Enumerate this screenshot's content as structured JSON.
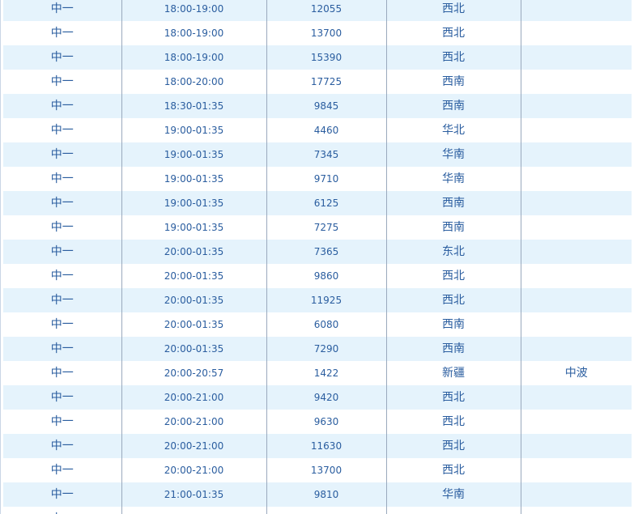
{
  "colors": {
    "stripe": "#e5f3fc",
    "text": "#2a5d9f",
    "divider": "#9aa9bd"
  },
  "rows": [
    {
      "channel": "中一",
      "time": "18:00-19:00",
      "freq": "12055",
      "region": "西北",
      "wave": ""
    },
    {
      "channel": "中一",
      "time": "18:00-19:00",
      "freq": "13700",
      "region": "西北",
      "wave": ""
    },
    {
      "channel": "中一",
      "time": "18:00-19:00",
      "freq": "15390",
      "region": "西北",
      "wave": ""
    },
    {
      "channel": "中一",
      "time": "18:00-20:00",
      "freq": "17725",
      "region": "西南",
      "wave": ""
    },
    {
      "channel": "中一",
      "time": "18:30-01:35",
      "freq": "9845",
      "region": "西南",
      "wave": ""
    },
    {
      "channel": "中一",
      "time": "19:00-01:35",
      "freq": "4460",
      "region": "华北",
      "wave": ""
    },
    {
      "channel": "中一",
      "time": "19:00-01:35",
      "freq": "7345",
      "region": "华南",
      "wave": ""
    },
    {
      "channel": "中一",
      "time": "19:00-01:35",
      "freq": "9710",
      "region": "华南",
      "wave": ""
    },
    {
      "channel": "中一",
      "time": "19:00-01:35",
      "freq": "6125",
      "region": "西南",
      "wave": ""
    },
    {
      "channel": "中一",
      "time": "19:00-01:35",
      "freq": "7275",
      "region": "西南",
      "wave": ""
    },
    {
      "channel": "中一",
      "time": "20:00-01:35",
      "freq": "7365",
      "region": "东北",
      "wave": ""
    },
    {
      "channel": "中一",
      "time": "20:00-01:35",
      "freq": "9860",
      "region": "西北",
      "wave": ""
    },
    {
      "channel": "中一",
      "time": "20:00-01:35",
      "freq": "11925",
      "region": "西北",
      "wave": ""
    },
    {
      "channel": "中一",
      "time": "20:00-01:35",
      "freq": "6080",
      "region": "西南",
      "wave": ""
    },
    {
      "channel": "中一",
      "time": "20:00-01:35",
      "freq": "7290",
      "region": "西南",
      "wave": ""
    },
    {
      "channel": "中一",
      "time": "20:00-20:57",
      "freq": "1422",
      "region": "新疆",
      "wave": "中波"
    },
    {
      "channel": "中一",
      "time": "20:00-21:00",
      "freq": "9420",
      "region": "西北",
      "wave": ""
    },
    {
      "channel": "中一",
      "time": "20:00-21:00",
      "freq": "9630",
      "region": "西北",
      "wave": ""
    },
    {
      "channel": "中一",
      "time": "20:00-21:00",
      "freq": "11630",
      "region": "西北",
      "wave": ""
    },
    {
      "channel": "中一",
      "time": "20:00-21:00",
      "freq": "13700",
      "region": "西北",
      "wave": ""
    },
    {
      "channel": "中一",
      "time": "21:00-01:35",
      "freq": "9810",
      "region": "华南",
      "wave": ""
    },
    {
      "channel": "中一",
      "time": "",
      "freq": "",
      "region": "",
      "wave": ""
    }
  ]
}
